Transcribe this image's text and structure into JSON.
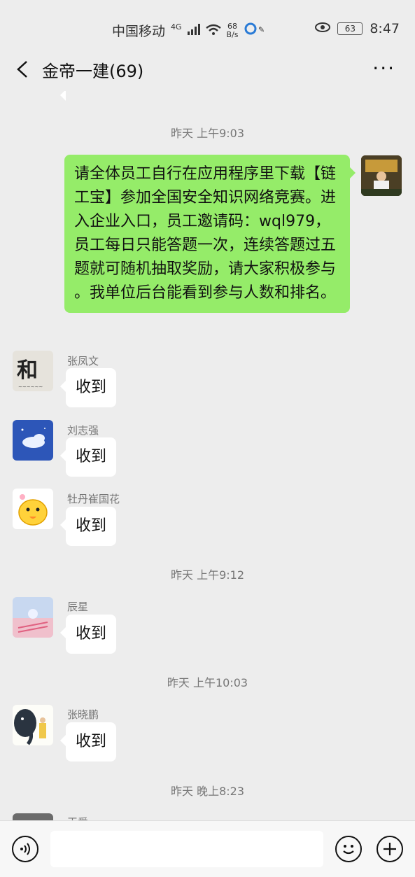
{
  "status_bar": {
    "carrier": "中国移动",
    "network": "4G",
    "speed_value": "68",
    "speed_unit": "B/s",
    "battery": "63",
    "time": "8:47"
  },
  "header": {
    "title": "金帝一建(69)"
  },
  "timestamps": {
    "t1": "昨天 上午9:03",
    "t2": "昨天 上午9:12",
    "t3": "昨天 上午10:03",
    "t4": "昨天 晚上8:23"
  },
  "messages": {
    "announcement": "请全体员工自行在应用程序里下载【链工宝】参加全国安全知识网络竞赛。进入企业入口，员工邀请码：wql979，员工每日只能答题一次，连续答题过五题就可随机抽取奖励，请大家积极参与 。我单位后台能看到参与人数和排名。",
    "zhang_fengwen": {
      "name": "张凤文",
      "text": "收到"
    },
    "liu_zhiqiang": {
      "name": "刘志强",
      "text": "收到"
    },
    "mudan": {
      "name": "牡丹崔国花",
      "text": "收到"
    },
    "chenxing": {
      "name": "辰星",
      "text": "收到"
    },
    "zhang_xiaopeng": {
      "name": "张晓鹏",
      "text": "收到"
    },
    "partial_name": "王爱"
  },
  "colors": {
    "own_bubble": "#95ec69",
    "other_bubble": "#ffffff",
    "background": "#ededed"
  },
  "icons": {
    "back": "chevron-left-icon",
    "more": "more-icon",
    "voice": "voice-icon",
    "emoji": "emoji-icon",
    "plus": "plus-icon"
  }
}
